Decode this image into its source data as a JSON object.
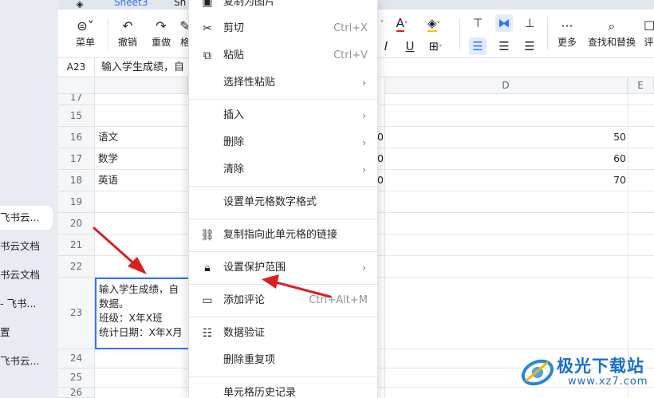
{
  "sidebar": {
    "items": [
      "飞书云...",
      "书云文档",
      "书云文档",
      "- 飞书...",
      "置",
      "飞书云..."
    ]
  },
  "tabs": {
    "first": "Sheet3",
    "second": "Sh"
  },
  "toolbar": {
    "menu": "菜单",
    "undo": "撤销",
    "redo": "重做",
    "brush": "格",
    "more": "更多",
    "find_replace": "查找和替换",
    "overflow": "评"
  },
  "formula_bar": {
    "cell_ref": "A23",
    "content": "输入学生成绩，自"
  },
  "columns": {
    "a": "",
    "d": "D",
    "e": "E"
  },
  "rows": [
    {
      "num": "17",
      "a": "",
      "c": "",
      "d": ""
    },
    {
      "num": "15",
      "a": "",
      "c": "",
      "d": ""
    },
    {
      "num": "16",
      "a": "语文",
      "c": "0",
      "d": "50"
    },
    {
      "num": "17",
      "a": "数学",
      "c": "0",
      "d": "60"
    },
    {
      "num": "18",
      "a": "英语",
      "c": "0",
      "d": "70"
    },
    {
      "num": "19",
      "a": "",
      "c": "",
      "d": ""
    },
    {
      "num": "20",
      "a": "",
      "c": "",
      "d": ""
    },
    {
      "num": "21",
      "a": "",
      "c": "",
      "d": ""
    },
    {
      "num": "22",
      "a": "",
      "c": "",
      "d": ""
    },
    {
      "num": "23",
      "a": "",
      "c": "",
      "d": ""
    },
    {
      "num": "24",
      "a": "",
      "c": "",
      "d": ""
    },
    {
      "num": "25",
      "a": "",
      "c": "",
      "d": ""
    },
    {
      "num": "26",
      "a": "",
      "c": "",
      "d": ""
    }
  ],
  "selected_cell": {
    "lines": [
      "输入学生成绩，自",
      "数据。",
      "班级：X年X班",
      "统计日期：X年X月"
    ]
  },
  "context_menu": {
    "items": [
      {
        "label": "复制为图片",
        "icon": "image-copy-icon",
        "shortcut": "",
        "arrow": ""
      },
      {
        "label": "剪切",
        "icon": "scissors-icon",
        "shortcut": "Ctrl+X",
        "arrow": ""
      },
      {
        "label": "粘贴",
        "icon": "paste-icon",
        "shortcut": "Ctrl+V",
        "arrow": ""
      },
      {
        "label": "选择性粘贴",
        "icon": "",
        "shortcut": "",
        "arrow": "›"
      },
      {
        "label": "插入",
        "icon": "",
        "shortcut": "",
        "arrow": "›"
      },
      {
        "label": "删除",
        "icon": "",
        "shortcut": "",
        "arrow": "›"
      },
      {
        "label": "清除",
        "icon": "",
        "shortcut": "",
        "arrow": "›"
      },
      {
        "label": "设置单元格数字格式",
        "icon": "",
        "shortcut": "",
        "arrow": ""
      },
      {
        "label": "复制指向此单元格的链接",
        "icon": "link-icon",
        "shortcut": "",
        "arrow": ""
      },
      {
        "label": "设置保护范围",
        "icon": "lock-icon",
        "shortcut": "",
        "arrow": "›"
      },
      {
        "label": "添加评论",
        "icon": "comment-icon",
        "shortcut": "Ctrl+Alt+M",
        "arrow": ""
      },
      {
        "label": "数据验证",
        "icon": "data-validation-icon",
        "shortcut": "",
        "arrow": ""
      },
      {
        "label": "删除重复项",
        "icon": "",
        "shortcut": "",
        "arrow": ""
      },
      {
        "label": "单元格历史记录",
        "icon": "",
        "shortcut": "",
        "arrow": ""
      }
    ]
  },
  "watermark": {
    "title": "极光下载站",
    "url": "www.xz7.com"
  },
  "colors": {
    "accent": "#3370ff",
    "arrow": "#d9201e",
    "watermark": "#1a6fc9"
  }
}
